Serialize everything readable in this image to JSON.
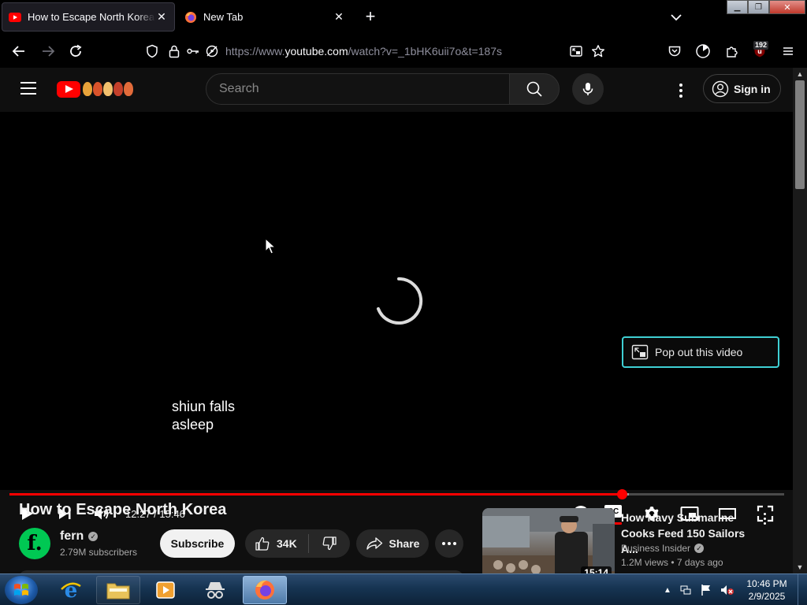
{
  "browser": {
    "tabs": [
      {
        "title": "How to Escape North Korea - YouTube",
        "active": true
      },
      {
        "title": "New Tab",
        "active": false
      }
    ],
    "new_tab_symbol": "+",
    "url_prefix": "https://www.",
    "url_host": "youtube.com",
    "url_path": "/watch?v=_1bHK6uii7o&t=187s",
    "extension_badge": "192"
  },
  "youtube": {
    "search_placeholder": "Search",
    "sign_in_label": "Sign in"
  },
  "player": {
    "caption_lines": [
      "shiun falls",
      "asleep"
    ],
    "popout_label": "Pop out this video",
    "current_time": "12:27",
    "duration": "15:46",
    "time_display": "12:27 / 15:46",
    "played_fraction": 0.7904,
    "buffered_fraction": 0.8
  },
  "video": {
    "title": "How to Escape North Korea",
    "channel_name": "fern",
    "channel_avatar_letter": "f.",
    "subscribers": "2.79M subscribers",
    "subscribe_label": "Subscribe",
    "likes": "34K",
    "share_label": "Share"
  },
  "recommendation": {
    "title": "How Navy Submarine Cooks Feed 150 Sailors A...",
    "channel": "Business Insider",
    "views": "1.2M views",
    "age": "7 days ago",
    "meta": "1.2M views  • 7 days ago",
    "duration": "15:14"
  },
  "taskbar": {
    "clock_time": "10:46 PM",
    "clock_date": "2/9/2025"
  },
  "colors": {
    "youtube_red": "#ff0000",
    "popout_border": "#3fd0d4",
    "page_bg": "#0f0f0f",
    "channel_avatar": "#00c853"
  }
}
